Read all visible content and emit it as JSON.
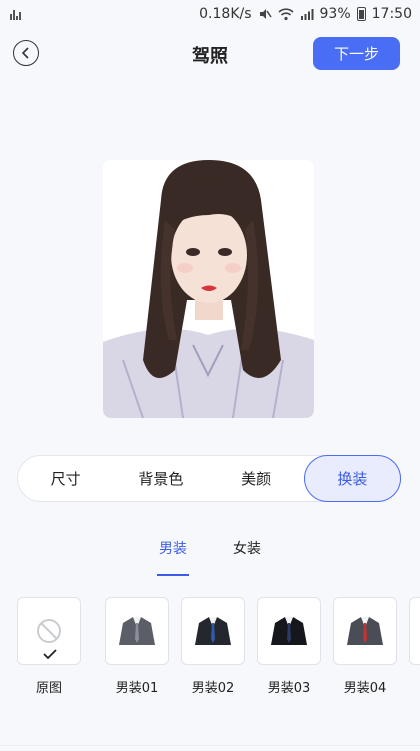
{
  "status": {
    "speed": "0.18K/s",
    "battery": "93%",
    "time": "17:50"
  },
  "header": {
    "title": "驾照",
    "next_label": "下一步"
  },
  "tabs": [
    {
      "label": "尺寸",
      "active": false
    },
    {
      "label": "背景色",
      "active": false
    },
    {
      "label": "美颜",
      "active": false
    },
    {
      "label": "换装",
      "active": true
    }
  ],
  "gender_tabs": [
    {
      "label": "男装",
      "active": true
    },
    {
      "label": "女装",
      "active": false
    }
  ],
  "outfits": [
    {
      "label": "原图",
      "selected": true,
      "icon": "no-outfit-icon"
    },
    {
      "label": "男装01",
      "tie": "#8a8f99"
    },
    {
      "label": "男装02",
      "tie": "#2f5aa8"
    },
    {
      "label": "男装03",
      "tie": "#2c3b66"
    },
    {
      "label": "男装04",
      "tie": "#c63232"
    }
  ],
  "colors": {
    "accent": "#4a6df5",
    "active_tab_bg": "#e8ecfd"
  }
}
